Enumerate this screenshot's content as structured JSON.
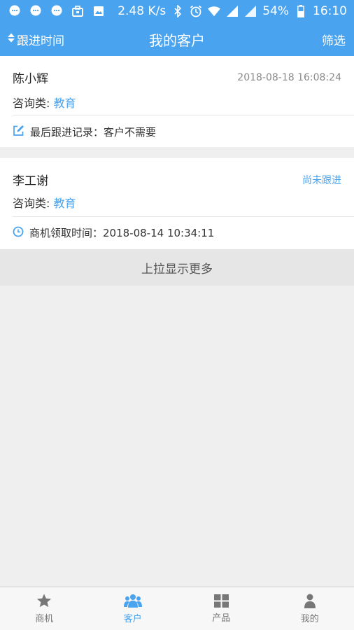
{
  "status_bar": {
    "speed": "2.48 K/s",
    "battery": "54%",
    "time": "16:10",
    "icons": [
      "chat-icon",
      "chat-icon",
      "chat-icon",
      "briefcase-icon",
      "image-icon",
      "bluetooth-icon",
      "alarm-icon",
      "wifi-icon",
      "signal-icon",
      "signal-icon",
      "battery-icon"
    ]
  },
  "header": {
    "sort_label": "跟进时间",
    "title": "我的客户",
    "filter_label": "筛选"
  },
  "customers": [
    {
      "name": "陈小辉",
      "right_text": "2018-08-18 16:08:24",
      "category_label": "咨询类: ",
      "category_value": "教育",
      "footer_text": "最后跟进记录：客户不需要",
      "footer_icon": "edit-icon"
    },
    {
      "name": "李工谢",
      "right_text": "尚未跟进",
      "category_label": "咨询类: ",
      "category_value": "教育",
      "footer_text": "商机领取时间：2018-08-14 10:34:11",
      "footer_icon": "clock-icon"
    }
  ],
  "load_more": "上拉显示更多",
  "tabs": [
    {
      "label": "商机",
      "icon": "star-icon",
      "active": false
    },
    {
      "label": "客户",
      "icon": "users-icon",
      "active": true
    },
    {
      "label": "产品",
      "icon": "grid-icon",
      "active": false
    },
    {
      "label": "我的",
      "icon": "person-icon",
      "active": false
    }
  ],
  "colors": {
    "accent": "#4aa3ee",
    "background": "#efefef",
    "tab_inactive": "#777777"
  }
}
